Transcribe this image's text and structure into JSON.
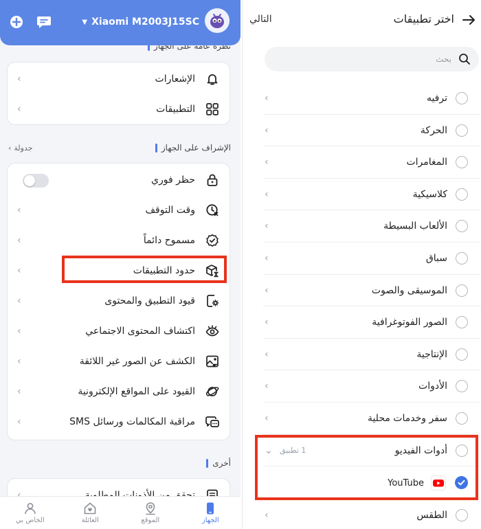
{
  "left": {
    "device_name": "Xiaomi M2003J15SC",
    "section_overview_title": "نظرة عامة على الجهاز",
    "overview_items": [
      {
        "label": "الإشعارات"
      },
      {
        "label": "التطبيقات"
      }
    ],
    "section_supervision_title": "الإشراف على الجهاز",
    "schedule_link": "جدولة",
    "supervision_items": [
      {
        "label": "حظر فوري",
        "toggle": false
      },
      {
        "label": "وقت التوقف"
      },
      {
        "label": "مسموح دائماً"
      },
      {
        "label": "حدود التطبيقات"
      },
      {
        "label": "قيود التطبيق والمحتوى"
      },
      {
        "label": "اكتشاف المحتوى الاجتماعي"
      },
      {
        "label": "الكشف عن الصور غير اللائقة"
      },
      {
        "label": "القيود على المواقع الإلكترونية"
      },
      {
        "label": "مراقبة المكالمات ورسائل SMS"
      }
    ],
    "section_other_title": "أخرى",
    "other_items": [
      {
        "label": "تحقق من الأذونات المطلوبة"
      }
    ],
    "bottom_nav": [
      {
        "label": "الجهاز",
        "active": true
      },
      {
        "label": "الموقع",
        "active": false
      },
      {
        "label": "العائلة",
        "active": false
      },
      {
        "label": "الخاص بي",
        "active": false
      }
    ]
  },
  "right": {
    "title": "اختر تطبيقات",
    "next_label": "التالي",
    "search_placeholder": "بحث",
    "categories": [
      {
        "label": "ترفيه"
      },
      {
        "label": "الحركة"
      },
      {
        "label": "المغامرات"
      },
      {
        "label": "كلاسيكية"
      },
      {
        "label": "الألعاب البسيطة"
      },
      {
        "label": "سباق"
      },
      {
        "label": "الموسيقى والصوت"
      },
      {
        "label": "الصور الفوتوغرافية"
      },
      {
        "label": "الإنتاجية"
      },
      {
        "label": "الأدوات"
      },
      {
        "label": "سفر وخدمات محلية"
      }
    ],
    "expanded_category": {
      "label": "أدوات الفيديو",
      "count": "1 تطبيق"
    },
    "expanded_app": {
      "name": "YouTube",
      "checked": true
    },
    "after_category": {
      "label": "الطقس"
    }
  },
  "colors": {
    "accent": "#4f7be8",
    "topbar": "#5b86e5",
    "highlight": "#e8331c",
    "youtube": "#ff0000"
  }
}
